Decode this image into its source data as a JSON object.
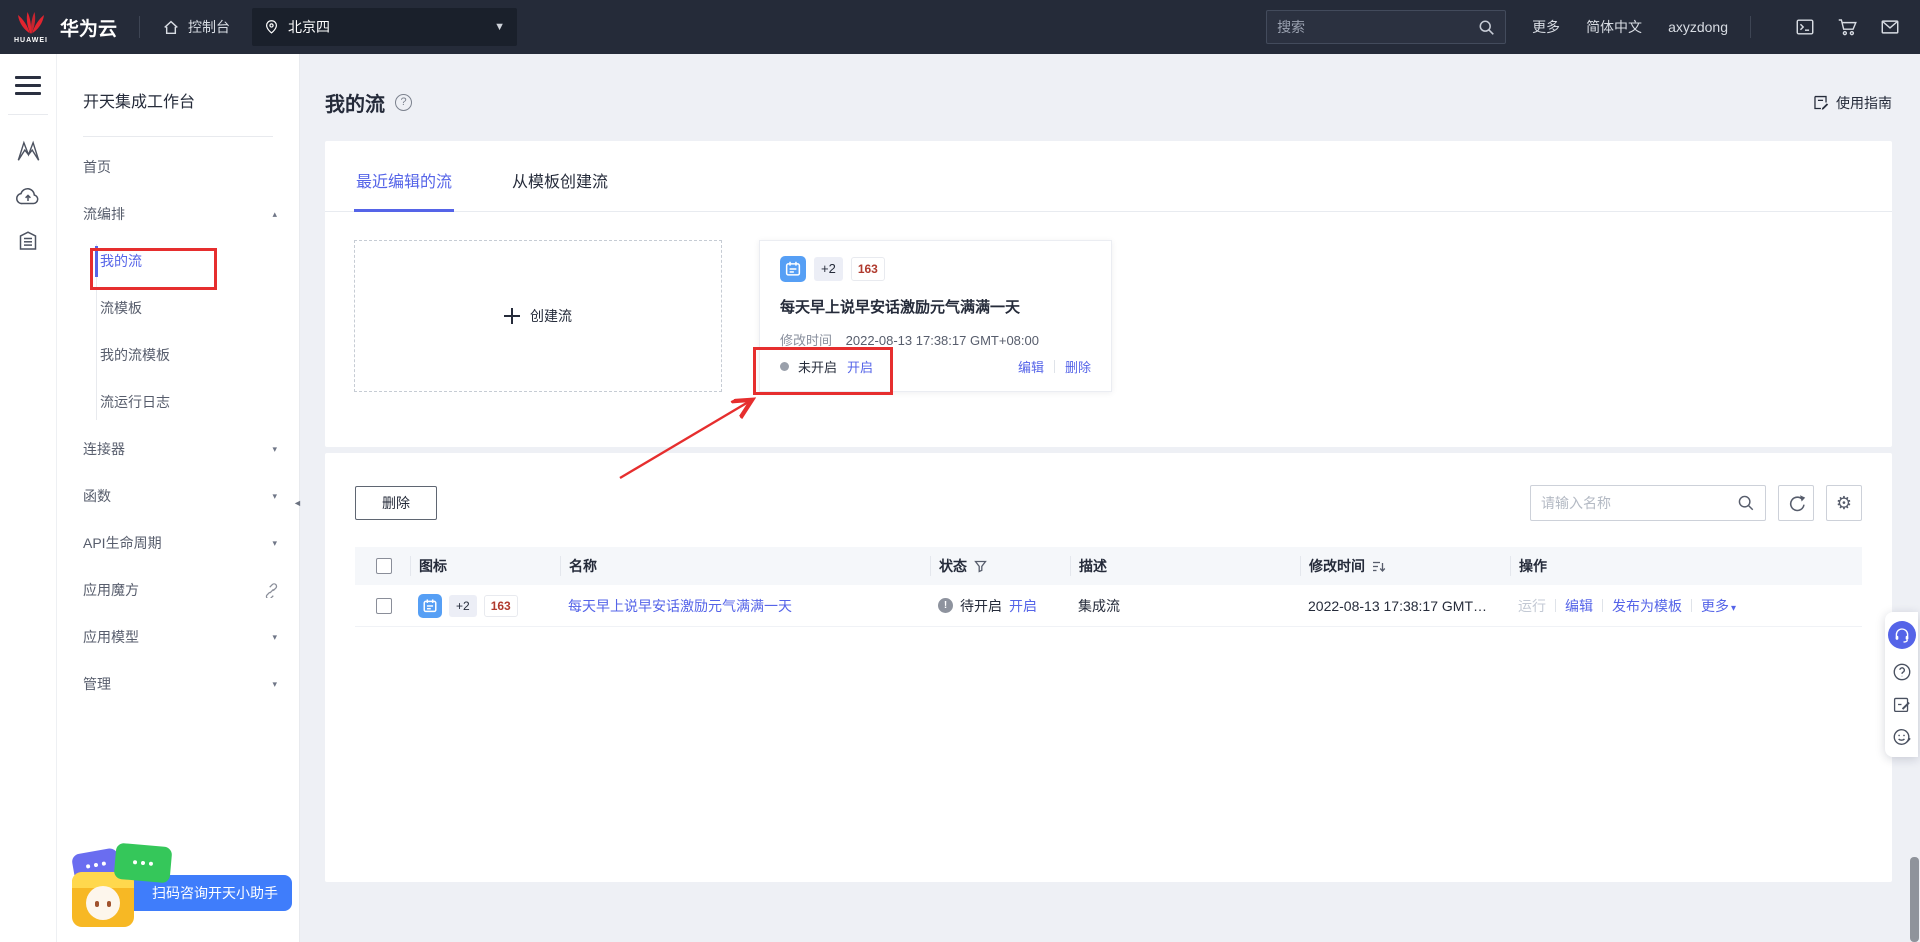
{
  "topbar": {
    "logo_text": "HUAWEI",
    "brand": "华为云",
    "console_label": "控制台",
    "region": "北京四",
    "search_placeholder": "搜索",
    "more_label": "更多",
    "language_label": "简体中文",
    "username": "axyzdong"
  },
  "sidebar": {
    "title": "开天集成工作台",
    "items": [
      {
        "label": "首页"
      },
      {
        "label": "流编排",
        "expanded": true
      },
      {
        "label": "我的流",
        "selected": true
      },
      {
        "label": "流模板"
      },
      {
        "label": "我的流模板"
      },
      {
        "label": "流运行日志"
      },
      {
        "label": "连接器"
      },
      {
        "label": "函数"
      },
      {
        "label": "API生命周期"
      },
      {
        "label": "应用魔方",
        "external": true
      },
      {
        "label": "应用模型"
      },
      {
        "label": "管理"
      }
    ]
  },
  "page": {
    "title": "我的流",
    "help": "?",
    "guide_label": "使用指南"
  },
  "tabs": {
    "recent": "最近编辑的流",
    "from_template": "从模板创建流"
  },
  "create_card": {
    "label": "创建流"
  },
  "flow_card": {
    "badge_plus": "+2",
    "badge_163": "163",
    "title": "每天早上说早安话激励元气满满一天",
    "modified_label": "修改时间",
    "modified_time": "2022-08-13 17:38:17 GMT+08:00",
    "status": "未开启",
    "enable_label": "开启",
    "edit_label": "编辑",
    "delete_label": "删除"
  },
  "list": {
    "delete_button": "删除",
    "search_placeholder": "请输入名称",
    "columns": [
      "图标",
      "名称",
      "状态",
      "描述",
      "修改时间",
      "操作"
    ],
    "row": {
      "badge_plus": "+2",
      "badge_163": "163",
      "name": "每天早上说早安话激励元气满满一天",
      "status": "待开启",
      "enable_label": "开启",
      "description": "集成流",
      "modified_time": "2022-08-13 17:38:17 GMT…",
      "actions": {
        "run": "运行",
        "edit": "编辑",
        "publish": "发布为模板",
        "more": "更多"
      }
    }
  },
  "mascot": {
    "banner": "扫码咨询开天小助手"
  },
  "icons": {
    "region_caret": "▾",
    "chevron_up": "▴",
    "chevron_down": "▾",
    "collapse": "◄",
    "settings_gear": "⚙",
    "more_caret": "▾",
    "status_info": "!"
  },
  "colors": {
    "accent_blue": "#5564e8",
    "annotation_red": "#e62e2e",
    "flow_icon_blue": "#569ff5",
    "badge163_red": "#b03a2e",
    "topbar_bg": "#252b39",
    "banner_blue": "#3f7dfb"
  }
}
